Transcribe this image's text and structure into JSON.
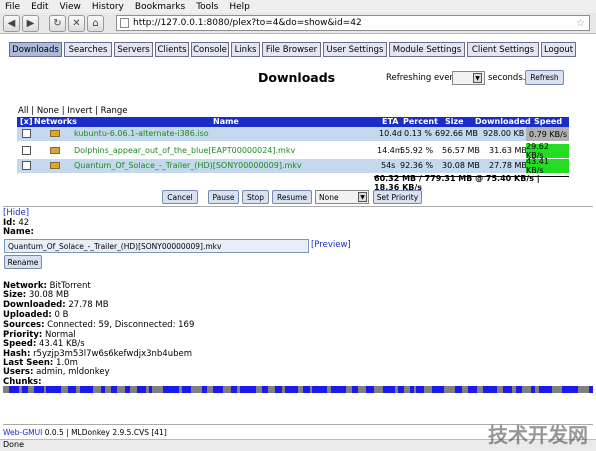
{
  "browser": {
    "menu": [
      "File",
      "Edit",
      "View",
      "History",
      "Bookmarks",
      "Tools",
      "Help"
    ],
    "url": "http://127.0.0.1:8080/plex?to=4&do=show&id=42"
  },
  "tabs": [
    "Downloads",
    "Searches",
    "Servers",
    "Clients",
    "Console",
    "Links",
    "File Browser",
    "User Settings",
    "Module Settings",
    "Client Settings",
    "Logout"
  ],
  "page": {
    "title": "Downloads",
    "refresh_label": "Refreshing every",
    "refresh_value": "",
    "seconds_label": "seconds.",
    "refresh_button": "Refresh"
  },
  "selectors": {
    "all": "All",
    "none": "None",
    "invert": "Invert",
    "range": "Range"
  },
  "table": {
    "headers": {
      "x": "[x]",
      "networks": "Networks",
      "name": "Name",
      "eta": "ETA",
      "percent": "Percent",
      "size": "Size",
      "downloaded": "Downloaded",
      "speed": "Speed"
    },
    "rows": [
      {
        "name": "kubuntu-6.06.1-alternate-i386.iso",
        "eta": "10.4d",
        "percent": "0.13 %",
        "size": "692.66 MB",
        "downloaded": "928.00 KB",
        "speed": "0.79 KB/s",
        "speed_color": "#b0b0b0",
        "row_bg": "#c4d8ee"
      },
      {
        "name": "Dolphins_appear_out_of_the_blue[EAPT00000024].mkv",
        "eta": "14.4m",
        "percent": "55.92 %",
        "size": "56.57 MB",
        "downloaded": "31.63 MB",
        "speed": "29.62 KB/s",
        "speed_color": "#22dd22",
        "row_bg": "#ffffff"
      },
      {
        "name": "Quantum_Of_Solace_-_Trailer_(HD)[SONY00000009].mkv",
        "eta": "54s",
        "percent": "92.36 %",
        "size": "30.08 MB",
        "downloaded": "27.78 MB",
        "speed": "43.41 KB/s",
        "speed_color": "#22dd22",
        "row_bg": "#c4d8ee"
      }
    ],
    "totals": "60.32 MB / 779.31 MB @ 75.40 KB/s | 18.36 KB/s"
  },
  "actions": {
    "cancel": "Cancel",
    "pause": "Pause",
    "stop": "Stop",
    "resume": "Resume",
    "priority_select": "None",
    "set_priority": "Set Priority"
  },
  "detail": {
    "hide": "[Hide]",
    "id_label": "Id:",
    "id": "42",
    "name_label": "Name:",
    "name_value": "Quantum_Of_Solace_-_Trailer_(HD)[SONY00000009].mkv",
    "preview": "[Preview]",
    "rename": "Rename",
    "fields": [
      {
        "label": "Network:",
        "value": "BitTorrent"
      },
      {
        "label": "Size:",
        "value": "30.08 MB"
      },
      {
        "label": "Downloaded:",
        "value": "27.78 MB"
      },
      {
        "label": "Uploaded:",
        "value": "0 B"
      },
      {
        "label": "Sources:",
        "value": "Connected: 59, Disconnected: 169"
      },
      {
        "label": "Priority:",
        "value": "Normal"
      },
      {
        "label": "Speed:",
        "value": "43.41 KB/s"
      },
      {
        "label": "Hash:",
        "value": "r5yzjp3m53l7w6s6kefwdjx3nb4ubem"
      },
      {
        "label": "Last Seen:",
        "value": "1.0m"
      },
      {
        "label": "Users:",
        "value": "admin, mldonkey"
      },
      {
        "label": "Chunks:",
        "value": ""
      }
    ]
  },
  "footer": {
    "link": "Web-GMUI",
    "text": " 0.0.5 | MLDonkey 2.9.5.CVS [41]"
  },
  "status": "Done",
  "watermark": "技术开发网"
}
